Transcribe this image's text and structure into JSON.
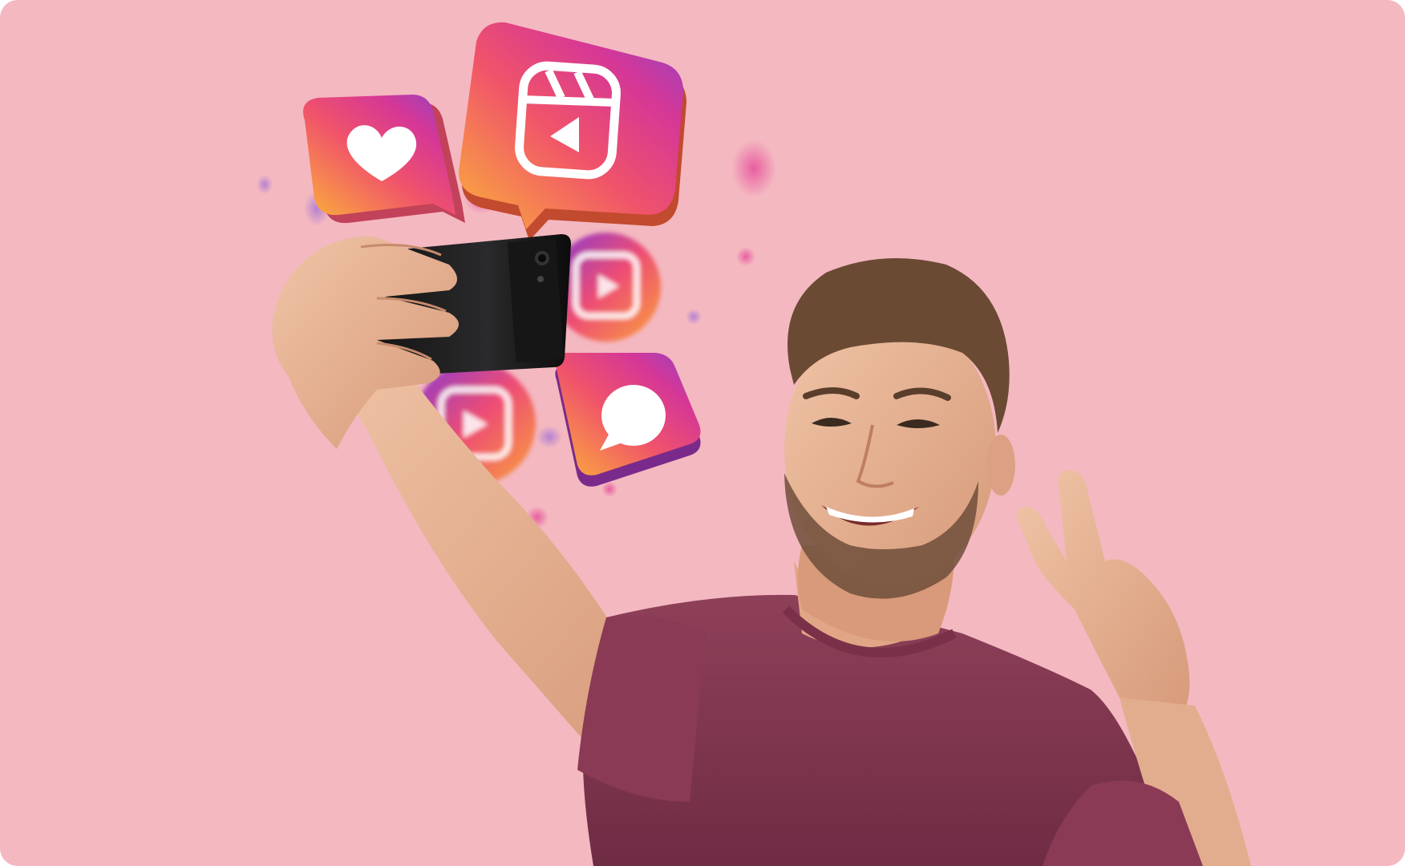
{
  "scene": {
    "description_icons": [
      "heart-icon",
      "reels-icon",
      "chat-bubble-icon"
    ],
    "colors": {
      "background": "#f4b8c1",
      "shirt": "#8a3a52",
      "skin": "#e8b293",
      "hair": "#6b4a34",
      "phone": "#1c1c1e",
      "gradient_start": "#f9a43a",
      "gradient_mid": "#e1306c",
      "gradient_end": "#8a3ab9"
    }
  }
}
